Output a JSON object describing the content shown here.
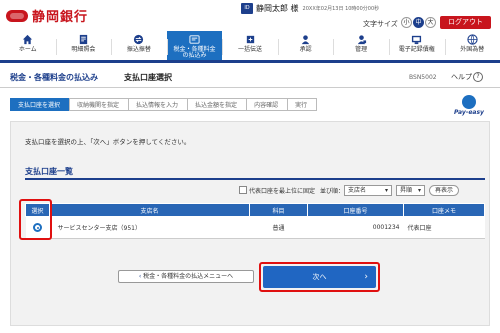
{
  "header": {
    "bank_name": "静岡銀行",
    "user_icon_label": "ID",
    "user_name": "静岡太郎 様",
    "last_login": "20XX年02月13日 10時00分00秒",
    "font_size_label": "文字サイズ",
    "font_sizes": [
      "小",
      "中",
      "大"
    ],
    "logout_label": "ログアウト"
  },
  "nav": {
    "items": [
      {
        "label": "ホーム",
        "icon": "home-icon"
      },
      {
        "label": "明細照会",
        "icon": "document-icon"
      },
      {
        "label": "振込振替",
        "icon": "transfer-icon"
      },
      {
        "label": "税金・各種料金の払込み",
        "icon": "tax-payment-icon"
      },
      {
        "label": "一括伝送",
        "icon": "batch-icon"
      },
      {
        "label": "承認",
        "icon": "approve-icon"
      },
      {
        "label": "管理",
        "icon": "manage-icon"
      },
      {
        "label": "電子記録債権",
        "icon": "e-bond-icon"
      },
      {
        "label": "外国為替",
        "icon": "forex-icon"
      }
    ]
  },
  "titlebar": {
    "category": "税金・各種料金の払込み",
    "title": "支払口座選択",
    "screen_code": "BSN5002",
    "help_label": "ヘルプ",
    "help_icon": "?"
  },
  "steps": [
    "支払口座を選択",
    "収納機関を指定",
    "払込情報を入力",
    "払込金額を指定",
    "内容確認",
    "実行"
  ],
  "payeasy": "Pay-easy",
  "main": {
    "message": "支払口座を選択の上、「次へ」ボタンを押してください。",
    "section_title": "支払口座一覧",
    "controls": {
      "checkbox_label": "代表口座を最上位に固定",
      "sort_label": "並び順：",
      "sort_value": "支店名",
      "order_value": "昇順",
      "redisplay_label": "再表示"
    },
    "table": {
      "headers": [
        "選択",
        "支店名",
        "科目",
        "口座番号",
        "口座メモ"
      ],
      "rows": [
        {
          "branch": "サービスセンター支店（951）",
          "type": "普通",
          "account": "0001234",
          "memo": "代表口座"
        }
      ]
    },
    "back_label": "税金・各種料金の払込メニューへ",
    "next_label": "次へ"
  },
  "colors": {
    "brand_red": "#c8151d",
    "nav_blue": "#1d3f8c",
    "accent_blue": "#1d6fc0",
    "highlight_red": "#e01010"
  }
}
